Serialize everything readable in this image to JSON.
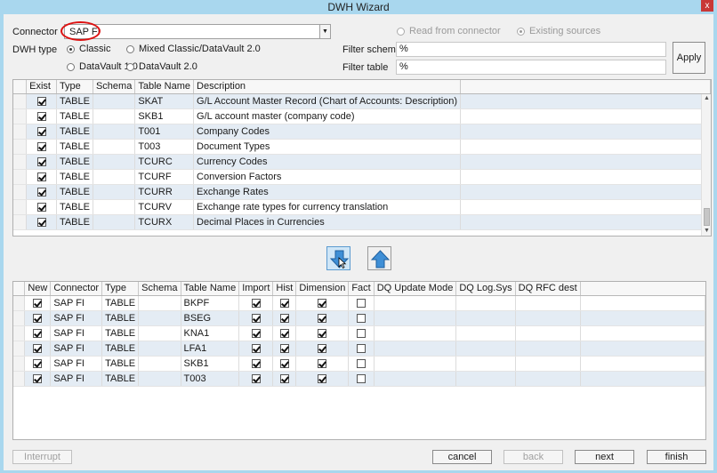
{
  "window": {
    "title": "DWH Wizard",
    "close_glyph": "x"
  },
  "connector": {
    "label": "Connector",
    "value": "SAP FI"
  },
  "dwh_type": {
    "label": "DWH type",
    "options": [
      {
        "label": "Classic",
        "selected": true
      },
      {
        "label": "Mixed Classic/DataVault 2.0",
        "selected": false
      },
      {
        "label": "DataVault 1.0",
        "selected": false
      },
      {
        "label": "DataVault 2.0",
        "selected": false
      }
    ]
  },
  "source_mode": {
    "options": [
      {
        "label": "Read from connector",
        "selected": false
      },
      {
        "label": "Existing sources",
        "selected": true
      }
    ]
  },
  "filters": {
    "schema_label": "Filter schema",
    "schema_value": "%",
    "table_label": "Filter table",
    "table_value": "%",
    "apply_label": "Apply"
  },
  "source_table": {
    "columns": [
      "Exist",
      "Type",
      "Schema",
      "Table Name",
      "Description"
    ],
    "rows": [
      {
        "exist": true,
        "type": "TABLE",
        "schema": "",
        "name": "SKAT",
        "description": "G/L Account Master Record (Chart of Accounts: Description)"
      },
      {
        "exist": true,
        "type": "TABLE",
        "schema": "",
        "name": "SKB1",
        "description": "G/L account master (company code)"
      },
      {
        "exist": true,
        "type": "TABLE",
        "schema": "",
        "name": "T001",
        "description": "Company Codes"
      },
      {
        "exist": true,
        "type": "TABLE",
        "schema": "",
        "name": "T003",
        "description": "Document Types"
      },
      {
        "exist": true,
        "type": "TABLE",
        "schema": "",
        "name": "TCURC",
        "description": "Currency Codes"
      },
      {
        "exist": true,
        "type": "TABLE",
        "schema": "",
        "name": "TCURF",
        "description": "Conversion Factors"
      },
      {
        "exist": true,
        "type": "TABLE",
        "schema": "",
        "name": "TCURR",
        "description": "Exchange Rates"
      },
      {
        "exist": true,
        "type": "TABLE",
        "schema": "",
        "name": "TCURV",
        "description": "Exchange rate types for currency translation"
      },
      {
        "exist": true,
        "type": "TABLE",
        "schema": "",
        "name": "TCURX",
        "description": "Decimal Places in Currencies"
      }
    ]
  },
  "transfer": {
    "down_icon": "arrow-down-icon",
    "up_icon": "arrow-up-icon"
  },
  "target_table": {
    "columns": [
      "New",
      "Connector",
      "Type",
      "Schema",
      "Table Name",
      "Import",
      "Hist",
      "Dimension",
      "Fact",
      "DQ Update Mode",
      "DQ Log.Sys",
      "DQ RFC dest"
    ],
    "rows": [
      {
        "new": true,
        "connector": "SAP FI",
        "type": "TABLE",
        "schema": "",
        "name": "BKPF",
        "import": true,
        "hist": true,
        "dimension": true,
        "fact": false,
        "dq_mode": "",
        "dq_log": "",
        "dq_rfc": ""
      },
      {
        "new": true,
        "connector": "SAP FI",
        "type": "TABLE",
        "schema": "",
        "name": "BSEG",
        "import": true,
        "hist": true,
        "dimension": true,
        "fact": false,
        "dq_mode": "",
        "dq_log": "",
        "dq_rfc": ""
      },
      {
        "new": true,
        "connector": "SAP FI",
        "type": "TABLE",
        "schema": "",
        "name": "KNA1",
        "import": true,
        "hist": true,
        "dimension": true,
        "fact": false,
        "dq_mode": "",
        "dq_log": "",
        "dq_rfc": ""
      },
      {
        "new": true,
        "connector": "SAP FI",
        "type": "TABLE",
        "schema": "",
        "name": "LFA1",
        "import": true,
        "hist": true,
        "dimension": true,
        "fact": false,
        "dq_mode": "",
        "dq_log": "",
        "dq_rfc": ""
      },
      {
        "new": true,
        "connector": "SAP FI",
        "type": "TABLE",
        "schema": "",
        "name": "SKB1",
        "import": true,
        "hist": true,
        "dimension": true,
        "fact": false,
        "dq_mode": "",
        "dq_log": "",
        "dq_rfc": ""
      },
      {
        "new": true,
        "connector": "SAP FI",
        "type": "TABLE",
        "schema": "",
        "name": "T003",
        "import": true,
        "hist": true,
        "dimension": true,
        "fact": false,
        "dq_mode": "",
        "dq_log": "",
        "dq_rfc": ""
      }
    ]
  },
  "footer": {
    "interrupt_label": "Interrupt",
    "cancel_label": "cancel",
    "back_label": "back",
    "next_label": "next",
    "finish_label": "finish"
  },
  "colors": {
    "title_bar": "#a9d7ee",
    "close": "#c83737",
    "row_alt": "#e4ecf4",
    "highlight_ellipse": "#dd1111",
    "arrow_blue": "#3f8fd6"
  }
}
